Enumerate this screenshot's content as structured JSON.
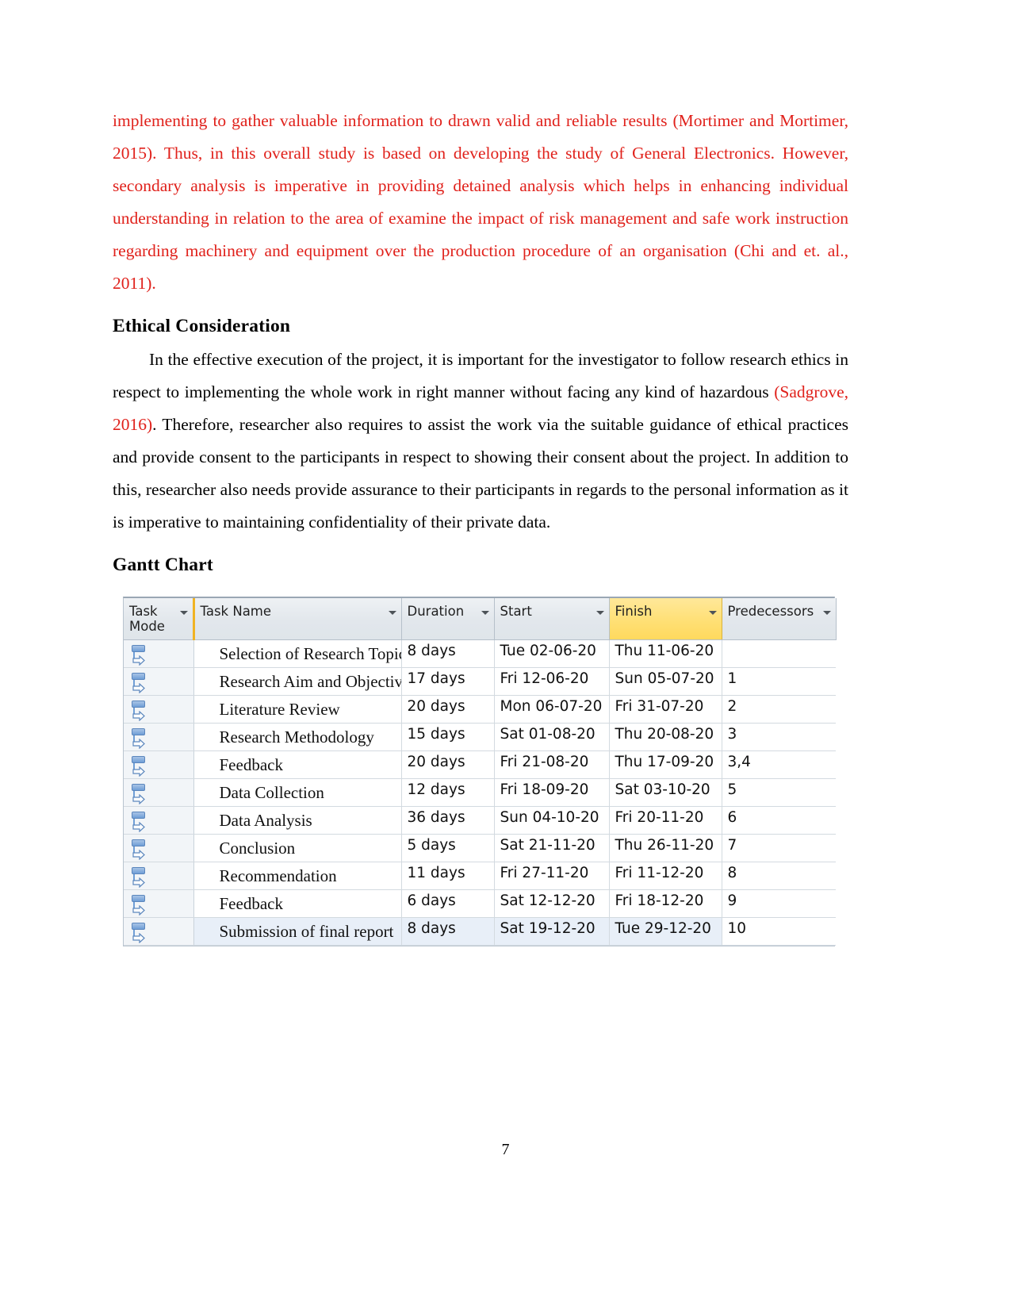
{
  "document": {
    "page_number": "7",
    "paragraphs": [
      {
        "id": "methodology-par",
        "color": "#e0211b",
        "text": "implementing  to gather valuable information to drawn valid and reliable results (Mortimer and Mortimer, 2015). Thus, in this overall study is based on developing the study of General Electronics. However, secondary analysis is imperative in providing detained analysis which helps in enhancing individual understanding in relation to the area of examine the impact of risk management and safe work instruction regarding machinery and equipment over the production procedure of an organisation (Chi and et. al., 2011)."
      }
    ],
    "headings": {
      "ethical_consideration": "Ethical Consideration",
      "gantt_chart": "Gantt Chart"
    },
    "ethical_paragraph": {
      "part1": "In the effective execution of the project, it is important for the investigator to follow research ethics in respect to implementing the whole work in right manner without facing any kind of hazardous ",
      "citation": "(Sadgrove, 2016)",
      "part2": ". Therefore, researcher also requires to assist the work via the suitable guidance of ethical practices and provide consent to the participants in respect to showing their consent about the project. In addition to this, researcher also needs provide assurance to their participants in regards to the personal information as it is imperative to maintaining confidentiality of their private data."
    }
  },
  "gantt": {
    "headers": [
      {
        "label": "Task Mode",
        "highlighted": false,
        "has_caret": true
      },
      {
        "label": "Task Name",
        "highlighted": false,
        "has_caret": true
      },
      {
        "label": "Duration",
        "highlighted": false,
        "has_caret": true
      },
      {
        "label": "Start",
        "highlighted": false,
        "has_caret": true
      },
      {
        "label": "Finish",
        "highlighted": true,
        "has_caret": true
      },
      {
        "label": "Predecessors",
        "highlighted": false,
        "has_caret": true
      }
    ],
    "highlight_color": "#ffd95e",
    "rows": [
      {
        "mode_icon": "auto-schedule-icon",
        "name": "Selection of Research Topic",
        "duration": "8 days",
        "start": "Tue 02-06-20",
        "finish": "Thu 11-06-20",
        "predecessors": ""
      },
      {
        "mode_icon": "auto-schedule-icon",
        "name": "Research Aim and Objectives",
        "duration": "17 days",
        "start": "Fri 12-06-20",
        "finish": "Sun 05-07-20",
        "predecessors": "1"
      },
      {
        "mode_icon": "auto-schedule-icon",
        "name": "Literature Review",
        "duration": "20 days",
        "start": "Mon 06-07-20",
        "finish": "Fri 31-07-20",
        "predecessors": "2"
      },
      {
        "mode_icon": "auto-schedule-icon",
        "name": "Research Methodology",
        "duration": "15 days",
        "start": "Sat 01-08-20",
        "finish": "Thu 20-08-20",
        "predecessors": "3"
      },
      {
        "mode_icon": "auto-schedule-icon",
        "name": "Feedback",
        "duration": "20 days",
        "start": "Fri 21-08-20",
        "finish": "Thu 17-09-20",
        "predecessors": "3,4"
      },
      {
        "mode_icon": "auto-schedule-icon",
        "name": "Data Collection",
        "duration": "12 days",
        "start": "Fri 18-09-20",
        "finish": "Sat 03-10-20",
        "predecessors": "5"
      },
      {
        "mode_icon": "auto-schedule-icon",
        "name": "Data Analysis",
        "duration": "36 days",
        "start": "Sun 04-10-20",
        "finish": "Fri 20-11-20",
        "predecessors": "6"
      },
      {
        "mode_icon": "auto-schedule-icon",
        "name": "Conclusion",
        "duration": "5 days",
        "start": "Sat 21-11-20",
        "finish": "Thu 26-11-20",
        "predecessors": "7"
      },
      {
        "mode_icon": "auto-schedule-icon",
        "name": "Recommendation",
        "duration": "11 days",
        "start": "Fri 27-11-20",
        "finish": "Fri 11-12-20",
        "predecessors": "8"
      },
      {
        "mode_icon": "auto-schedule-icon",
        "name": "Feedback",
        "duration": "6 days",
        "start": "Sat 12-12-20",
        "finish": "Fri 18-12-20",
        "predecessors": "9"
      },
      {
        "mode_icon": "auto-schedule-icon",
        "name": "Submission of final report",
        "duration": "8 days",
        "start": "Sat 19-12-20",
        "finish": "Tue 29-12-20",
        "predecessors": "10"
      }
    ]
  }
}
